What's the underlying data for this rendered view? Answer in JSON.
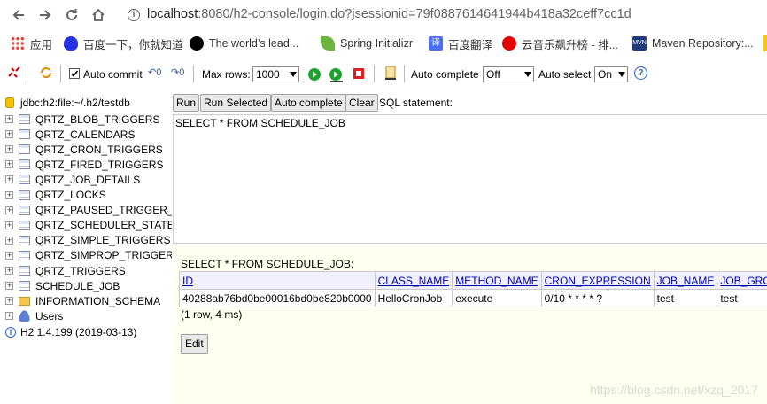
{
  "browser": {
    "url_host": "localhost",
    "url_rest": ":8080/h2-console/login.do?jsessionid=79f0887614641944b418a32ceff7cc1d",
    "bookmarks": [
      {
        "label": "应用",
        "icon": "apps-grid-icon",
        "color": "#4285f4"
      },
      {
        "label": "百度一下，你就知道",
        "icon": "baidu-paw-icon",
        "color": "#2932e1"
      },
      {
        "label": "The world’s lead...",
        "icon": "github-icon",
        "color": "#000000"
      },
      {
        "label": "Spring Initializr",
        "icon": "spring-leaf-icon",
        "color": "#6db33f"
      },
      {
        "label": "百度翻译",
        "icon": "translate-icon",
        "color": "#4e6ef2"
      },
      {
        "label": "云音乐飙升榜 - 排...",
        "icon": "netease-music-icon",
        "color": "#e20000"
      },
      {
        "label": "Maven Repository:...",
        "icon": "maven-icon",
        "color": "#1f3a7a"
      }
    ]
  },
  "toolbar": {
    "auto_commit_label": "Auto commit",
    "auto_commit_checked": true,
    "max_rows_label": "Max rows:",
    "max_rows_value": "1000",
    "auto_complete_label": "Auto complete",
    "auto_complete_value": "Off",
    "auto_select_label": "Auto select",
    "auto_select_value": "On",
    "help_symbol": "?"
  },
  "tree": {
    "connection": "jdbc:h2:file:~/.h2/testdb",
    "tables": [
      "QRTZ_BLOB_TRIGGERS",
      "QRTZ_CALENDARS",
      "QRTZ_CRON_TRIGGERS",
      "QRTZ_FIRED_TRIGGERS",
      "QRTZ_JOB_DETAILS",
      "QRTZ_LOCKS",
      "QRTZ_PAUSED_TRIGGER_",
      "QRTZ_SCHEDULER_STATE",
      "QRTZ_SIMPLE_TRIGGERS",
      "QRTZ_SIMPROP_TRIGGER",
      "QRTZ_TRIGGERS",
      "SCHEDULE_JOB"
    ],
    "schema": "INFORMATION_SCHEMA",
    "users": "Users",
    "version": "H2 1.4.199 (2019-03-13)"
  },
  "query": {
    "buttons": [
      "Run",
      "Run Selected",
      "Auto complete",
      "Clear"
    ],
    "sql_label": "SQL statement:",
    "sql_text": "SELECT * FROM SCHEDULE_JOB"
  },
  "results": {
    "statement": "SELECT * FROM SCHEDULE_JOB;",
    "columns": [
      "ID",
      "CLASS_NAME",
      "METHOD_NAME",
      "CRON_EXPRESSION",
      "JOB_NAME",
      "JOB_GROU"
    ],
    "rows": [
      [
        "40288ab76bd0be00016bd0be820b0000",
        "HelloCronJob",
        "execute",
        "0/10 * * * * ?",
        "test",
        "test"
      ]
    ],
    "row_info": "(1 row, 4 ms)",
    "edit_label": "Edit"
  },
  "watermark": "https://blog.csdn.net/xzq_2017"
}
